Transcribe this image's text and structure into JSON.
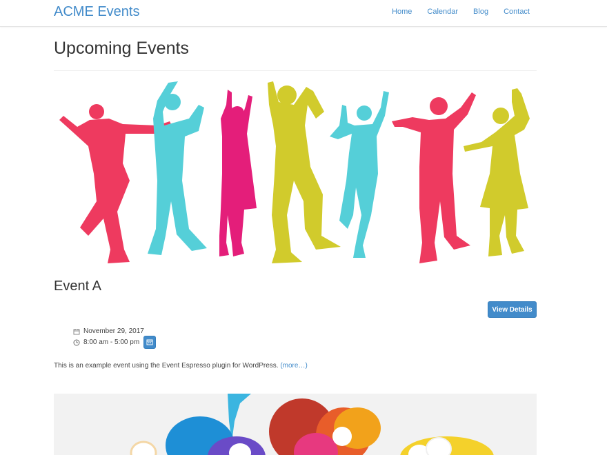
{
  "site": {
    "brand": "ACME Events",
    "nav": [
      "Home",
      "Calendar",
      "Blog",
      "Contact"
    ]
  },
  "page": {
    "title": "Upcoming Events"
  },
  "hero_image": {
    "description": "colorful dancing silhouettes",
    "colors": [
      "#ee3a5f",
      "#55cfd8",
      "#e41e7a",
      "#d1cb2c"
    ]
  },
  "event": {
    "title": "Event A",
    "details_button": "View Details",
    "date": "November 29, 2017",
    "time": "8:00 am - 5:00 pm",
    "description": "This is an example event using the Event Espresso plugin for WordPress.",
    "more_link": "(more…)"
  },
  "icons": {
    "date": "calendar-icon",
    "time": "clock-icon",
    "add_to_calendar": "calendar-add-icon"
  },
  "colors": {
    "link": "#428bca",
    "button": "#428bca"
  }
}
